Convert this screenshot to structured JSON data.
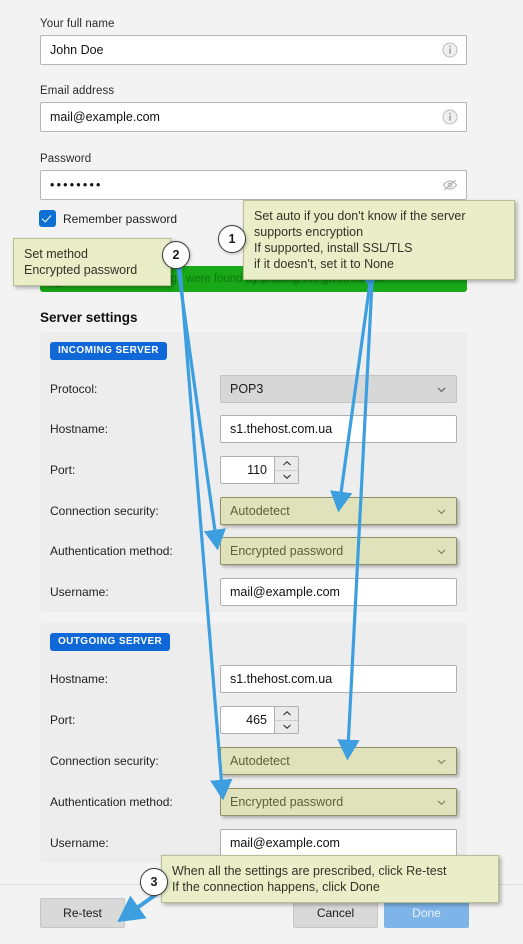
{
  "account": {
    "name_label": "Your full name",
    "name_value": "John Doe",
    "email_label": "Email address",
    "email_value": "mail@example.com",
    "password_label": "Password",
    "password_value": "••••••••",
    "remember_label": "Remember password",
    "info_icon": "info-icon",
    "reveal_icon": "eye-off-icon"
  },
  "banner": {
    "text": "The following settings were found by probing the given server",
    "color": "#18a818"
  },
  "server": {
    "section_title": "Server settings",
    "incoming": {
      "badge": "INCOMING SERVER",
      "protocol_label": "Protocol:",
      "protocol_value": "POP3",
      "hostname_label": "Hostname:",
      "hostname_value": "s1.thehost.com.ua",
      "port_label": "Port:",
      "port_value": "110",
      "security_label": "Connection security:",
      "security_value": "Autodetect",
      "auth_label": "Authentication method:",
      "auth_value": "Encrypted password",
      "username_label": "Username:",
      "username_value": "mail@example.com"
    },
    "outgoing": {
      "badge": "OUTGOING SERVER",
      "hostname_label": "Hostname:",
      "hostname_value": "s1.thehost.com.ua",
      "port_label": "Port:",
      "port_value": "465",
      "security_label": "Connection security:",
      "security_value": "Autodetect",
      "auth_label": "Authentication method:",
      "auth_value": "Encrypted password",
      "username_label": "Username:",
      "username_value": "mail@example.com"
    }
  },
  "footer": {
    "retest_label": "Re-test",
    "cancel_label": "Cancel",
    "done_label": "Done"
  },
  "annotations": {
    "one": {
      "number": "1",
      "text": "Set auto if you don't know if the server\nsupports encryption\nIf supported, install SSL/TLS\nif it doesn't, set it to None"
    },
    "two": {
      "number": "2",
      "text": "Set method\nEncrypted password"
    },
    "three": {
      "number": "3",
      "text": "When all the settings are prescribed, click Re-test\nIf the connection happens, click Done"
    },
    "accent_color": "#3d9fe0",
    "callout_bg": "#e9eec9"
  }
}
